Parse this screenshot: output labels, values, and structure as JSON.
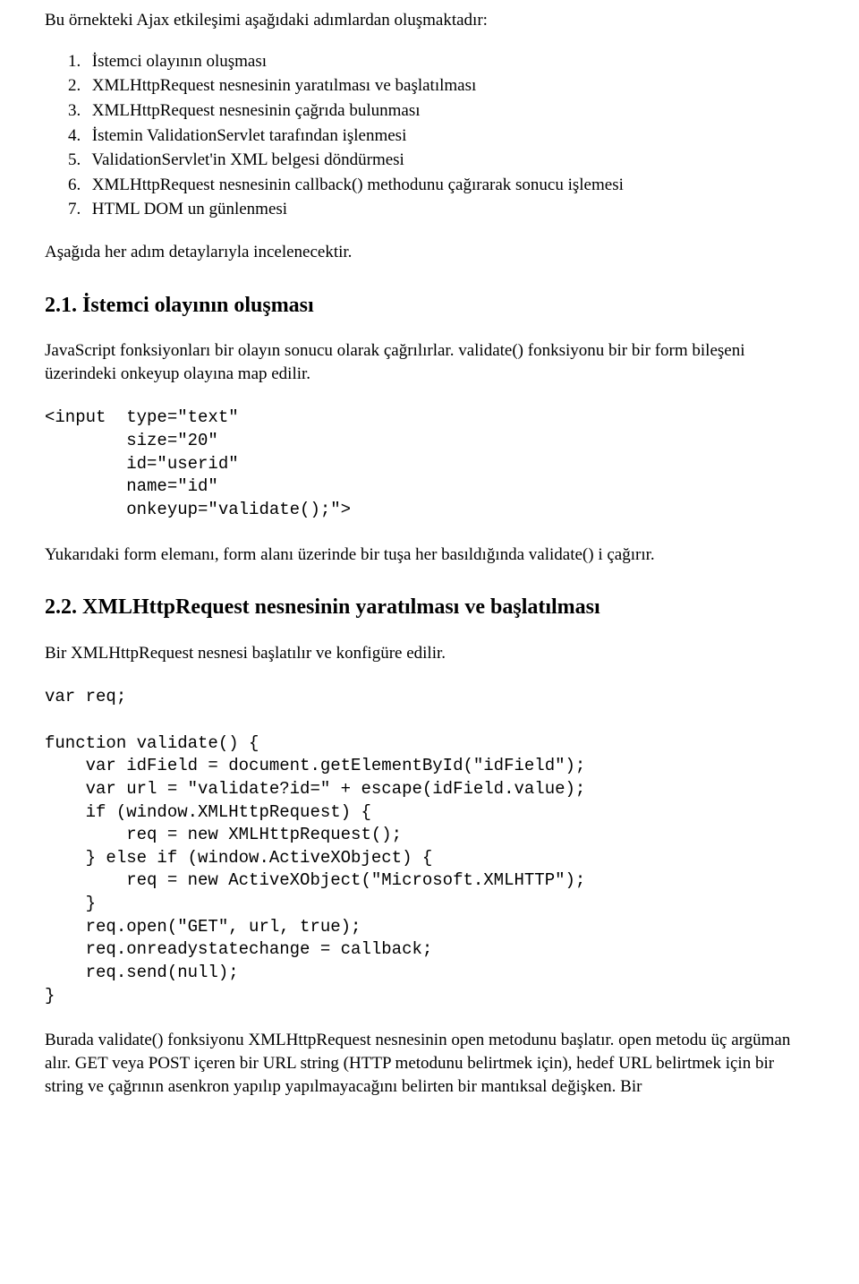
{
  "intro": "Bu örnekteki Ajax etkileşimi aşağıdaki adımlardan oluşmaktadır:",
  "steps": [
    {
      "n": "1.",
      "t": "İstemci olayının oluşması"
    },
    {
      "n": "2.",
      "t": "XMLHttpRequest nesnesinin yaratılması ve başlatılması"
    },
    {
      "n": "3.",
      "t": "XMLHttpRequest nesnesinin çağrıda bulunması"
    },
    {
      "n": "4.",
      "t": "İstemin ValidationServlet tarafından işlenmesi"
    },
    {
      "n": "5.",
      "t": "ValidationServlet'in XML belgesi döndürmesi"
    },
    {
      "n": "6.",
      "t": "XMLHttpRequest nesnesinin callback() methodunu çağırarak sonucu işlemesi"
    },
    {
      "n": "7.",
      "t": "HTML DOM un günlenmesi"
    }
  ],
  "after_steps": "Aşağıda her adım detaylarıyla incelenecektir.",
  "s21": {
    "heading": "2.1. İstemci olayının oluşması",
    "p": "JavaScript fonksiyonları bir olayın sonucu olarak çağrılırlar. validate() fonksiyonu bir bir form bileşeni üzerindeki onkeyup olayına map edilir.",
    "code": "<input  type=\"text\"\n        size=\"20\"\n        id=\"userid\"\n        name=\"id\"\n        onkeyup=\"validate();\">",
    "after": "Yukarıdaki form elemanı, form alanı üzerinde bir tuşa her basıldığında validate() i çağırır."
  },
  "s22": {
    "heading": "2.2. XMLHttpRequest nesnesinin yaratılması ve başlatılması",
    "p": "Bir XMLHttpRequest nesnesi başlatılır ve konfigüre edilir.",
    "code": "var req;\n\nfunction validate() {\n    var idField = document.getElementById(\"idField\");\n    var url = \"validate?id=\" + escape(idField.value);\n    if (window.XMLHttpRequest) {\n        req = new XMLHttpRequest();\n    } else if (window.ActiveXObject) {\n        req = new ActiveXObject(\"Microsoft.XMLHTTP\");\n    }\n    req.open(\"GET\", url, true);\n    req.onreadystatechange = callback;\n    req.send(null);\n}",
    "after": "Burada validate() fonksiyonu XMLHttpRequest nesnesinin open metodunu başlatır. open metodu üç argüman alır. GET veya POST içeren bir URL string (HTTP metodunu belirtmek için), hedef URL belirtmek için bir string ve çağrının asenkron yapılıp yapılmayacağını belirten bir mantıksal değişken. Bir"
  }
}
